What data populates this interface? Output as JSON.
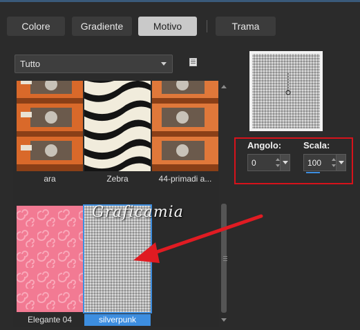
{
  "tabs": [
    {
      "label": "Colore"
    },
    {
      "label": "Gradiente"
    },
    {
      "label": "Motivo",
      "active": true
    },
    {
      "label": "Trama"
    }
  ],
  "category_dropdown": {
    "value": "Tutto"
  },
  "patterns": [
    {
      "name": "ara"
    },
    {
      "name": "Zebra"
    },
    {
      "name": "44-primadi a..."
    },
    {
      "name": "Elegante 04"
    },
    {
      "name": "silverpunk",
      "selected": true
    }
  ],
  "controls": {
    "angolo": {
      "label": "Angolo:",
      "value": "0"
    },
    "scala": {
      "label": "Scala:",
      "value": "100"
    }
  },
  "watermark": "Graficamia",
  "colors": {
    "selection": "#3d8ee0",
    "highlight_box": "#d8121b",
    "arrow": "#e01b22",
    "background": "#2b2b2b"
  }
}
